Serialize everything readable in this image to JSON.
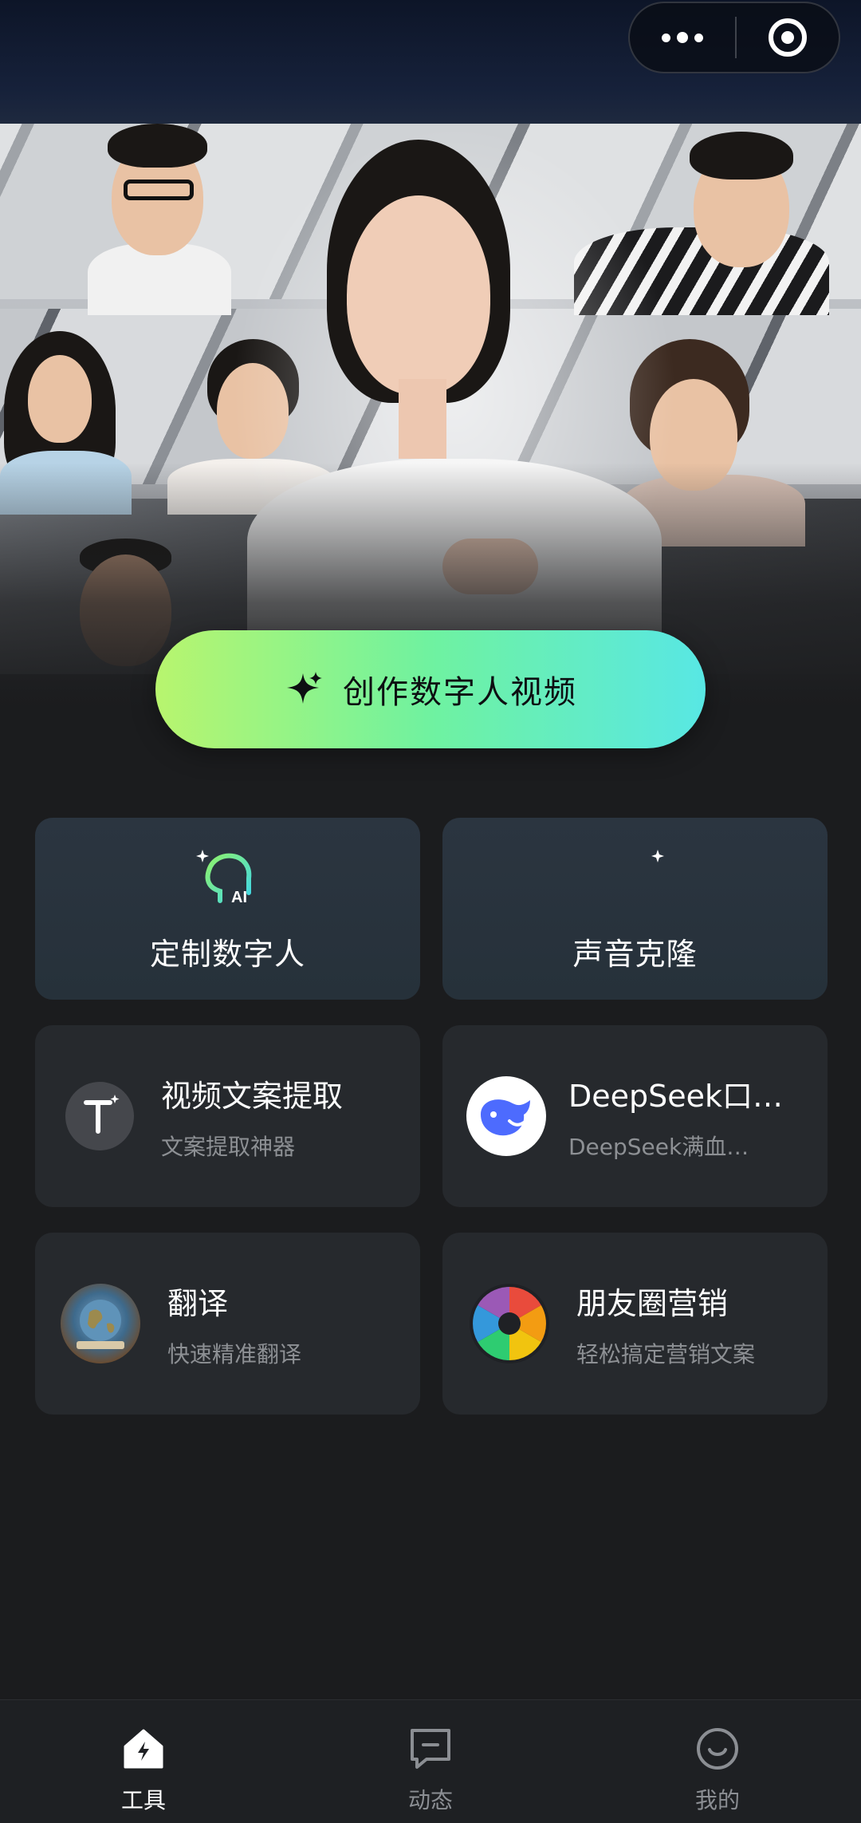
{
  "hero": {
    "cta_label": "创作数字人视频"
  },
  "features": {
    "custom_avatar": {
      "title": "定制数字人"
    },
    "voice_clone": {
      "title": "声音克隆"
    },
    "video_copy": {
      "title": "视频文案提取",
      "subtitle": "文案提取神器"
    },
    "deepseek": {
      "title": "DeepSeek口…",
      "subtitle": "DeepSeek满血…"
    },
    "translate": {
      "title": "翻译",
      "subtitle": "快速精准翻译"
    },
    "moments": {
      "title": "朋友圈营销",
      "subtitle": "轻松搞定营销文案"
    }
  },
  "tabbar": {
    "tools": "工具",
    "feed": "动态",
    "mine": "我的"
  },
  "colors": {
    "background": "#1b1c1e",
    "cta_gradient": [
      "#b8f56e",
      "#6ff2a0",
      "#58e7e4"
    ],
    "card": "#26292d",
    "subtitle": "#8d9094"
  },
  "icons": {
    "capsule_more": "more-dots-icon",
    "capsule_close": "target-close-icon",
    "cta": "sparkle-icon",
    "custom_avatar": "ai-head-icon",
    "voice_clone": "sound-wave-icon",
    "video_copy": "text-t-icon",
    "deepseek": "whale-icon",
    "translate": "globe-icon",
    "moments": "aperture-icon",
    "tab_tools": "bolt-house-icon",
    "tab_feed": "message-square-icon",
    "tab_mine": "smile-circle-icon"
  }
}
